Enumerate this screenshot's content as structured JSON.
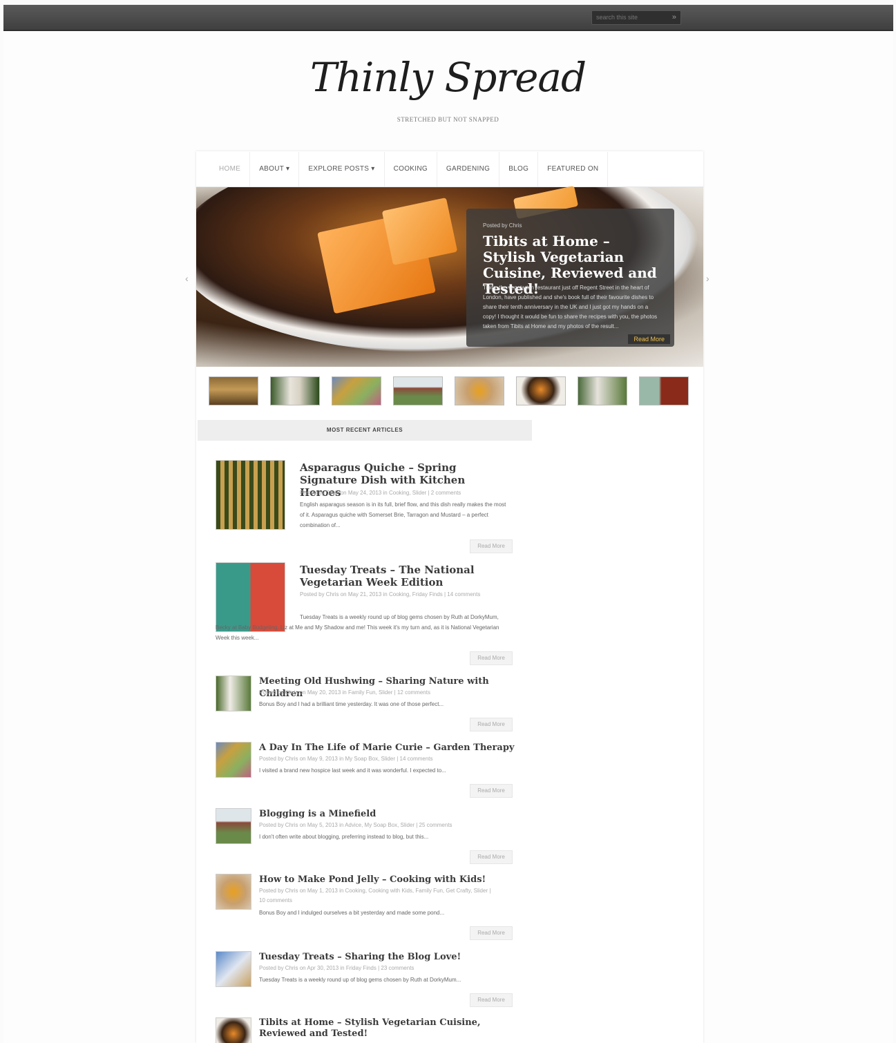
{
  "search": {
    "placeholder": "search this site",
    "button": "»"
  },
  "site": {
    "title": "Thinly Spread",
    "tagline": "STRETCHED BUT NOT SNAPPED"
  },
  "nav": [
    "HOME",
    "ABOUT ▾",
    "EXPLORE POSTS ▾",
    "COOKING",
    "GARDENING",
    "BLOG",
    "FEATURED ON"
  ],
  "slider": {
    "byline": "Posted by Chris",
    "title": "Tibits at Home – Stylish Vegetarian Cuisine, Reviewed and Tested!",
    "excerpt": "Tibits, the vegetarian restaurant just off Regent Street in the heart of London, have published and she's book full of their favourite dishes to share their tenth anniversary in the UK and I just got my hands on a copy! I thought it would be fun to share the recipes with you, the photos taken from Tibits at Home and my photos of the result...",
    "more": "Read More",
    "prev": "‹",
    "next": "›"
  },
  "recent": {
    "heading": "MOST RECENT ARTICLES",
    "articles": [
      {
        "title": "Asparagus Quiche – Spring Signature Dish with Kitchen Heroes",
        "meta": "Posted by Chris on May 24, 2013 in Cooking, Slider | 2 comments",
        "excerpt": "English asparagus season is in its full, brief flow, and this dish really makes the most of it. Asparagus quiche with Somerset Brie, Tarragon and Mustard – a perfect combination of...",
        "more": "Read More"
      },
      {
        "title": "Tuesday Treats – The National Vegetarian Week Edition",
        "meta": "Posted by Chris on May 21, 2013 in Cooking, Friday Finds | 14 comments",
        "excerpt": "Tuesday Treats is a weekly round up of blog gems chosen by Ruth at DorkyMum, Becky at Baby Budgeting, Liz at Me and My Shadow and me! This week it's my turn and, as it is National Vegetarian Week this week...",
        "more": "Read More"
      },
      {
        "title": "Meeting Old Hushwing – Sharing Nature with Children",
        "meta": "Posted by Chris on May 20, 2013 in Family Fun, Slider | 12 comments",
        "excerpt": "Bonus Boy and I had a brilliant time yesterday. It was one of those perfect...",
        "more": "Read More"
      },
      {
        "title": "A Day In The Life of Marie Curie – Garden Therapy",
        "meta": "Posted by Chris on May 9, 2013 in My Soap Box, Slider | 14 comments",
        "excerpt": "I visited a brand new hospice last week and it was wonderful. I expected to...",
        "more": "Read More"
      },
      {
        "title": "Blogging is a Minefield",
        "meta": "Posted by Chris on May 5, 2013 in Advice, My Soap Box, Slider | 25 comments",
        "excerpt": "I don't often write about blogging, preferring instead to blog, but this...",
        "more": "Read More"
      },
      {
        "title": "How to Make Pond Jelly – Cooking with Kids!",
        "meta": "Posted by Chris on May 1, 2013 in Cooking, Cooking with Kids, Family Fun, Get Crafty, Slider | 10 comments",
        "excerpt": "Bonus Boy and I indulged ourselves a bit yesterday and made some pond...",
        "more": "Read More"
      },
      {
        "title": "Tuesday Treats – Sharing the Blog Love!",
        "meta": "Posted by Chris on Apr 30, 2013 in Friday Finds | 23 comments",
        "excerpt": "Tuesday Treats is a weekly round up of blog gems chosen by Ruth at DorkyMum...",
        "more": "Read More"
      },
      {
        "title": "Tibits at Home – Stylish Vegetarian Cuisine, Reviewed and Tested!",
        "meta": "",
        "excerpt": "",
        "more": ""
      }
    ]
  },
  "colors": {
    "topbar": "#454545",
    "accent": "#f3c24a",
    "caption_bg": "#3c3c3c"
  }
}
